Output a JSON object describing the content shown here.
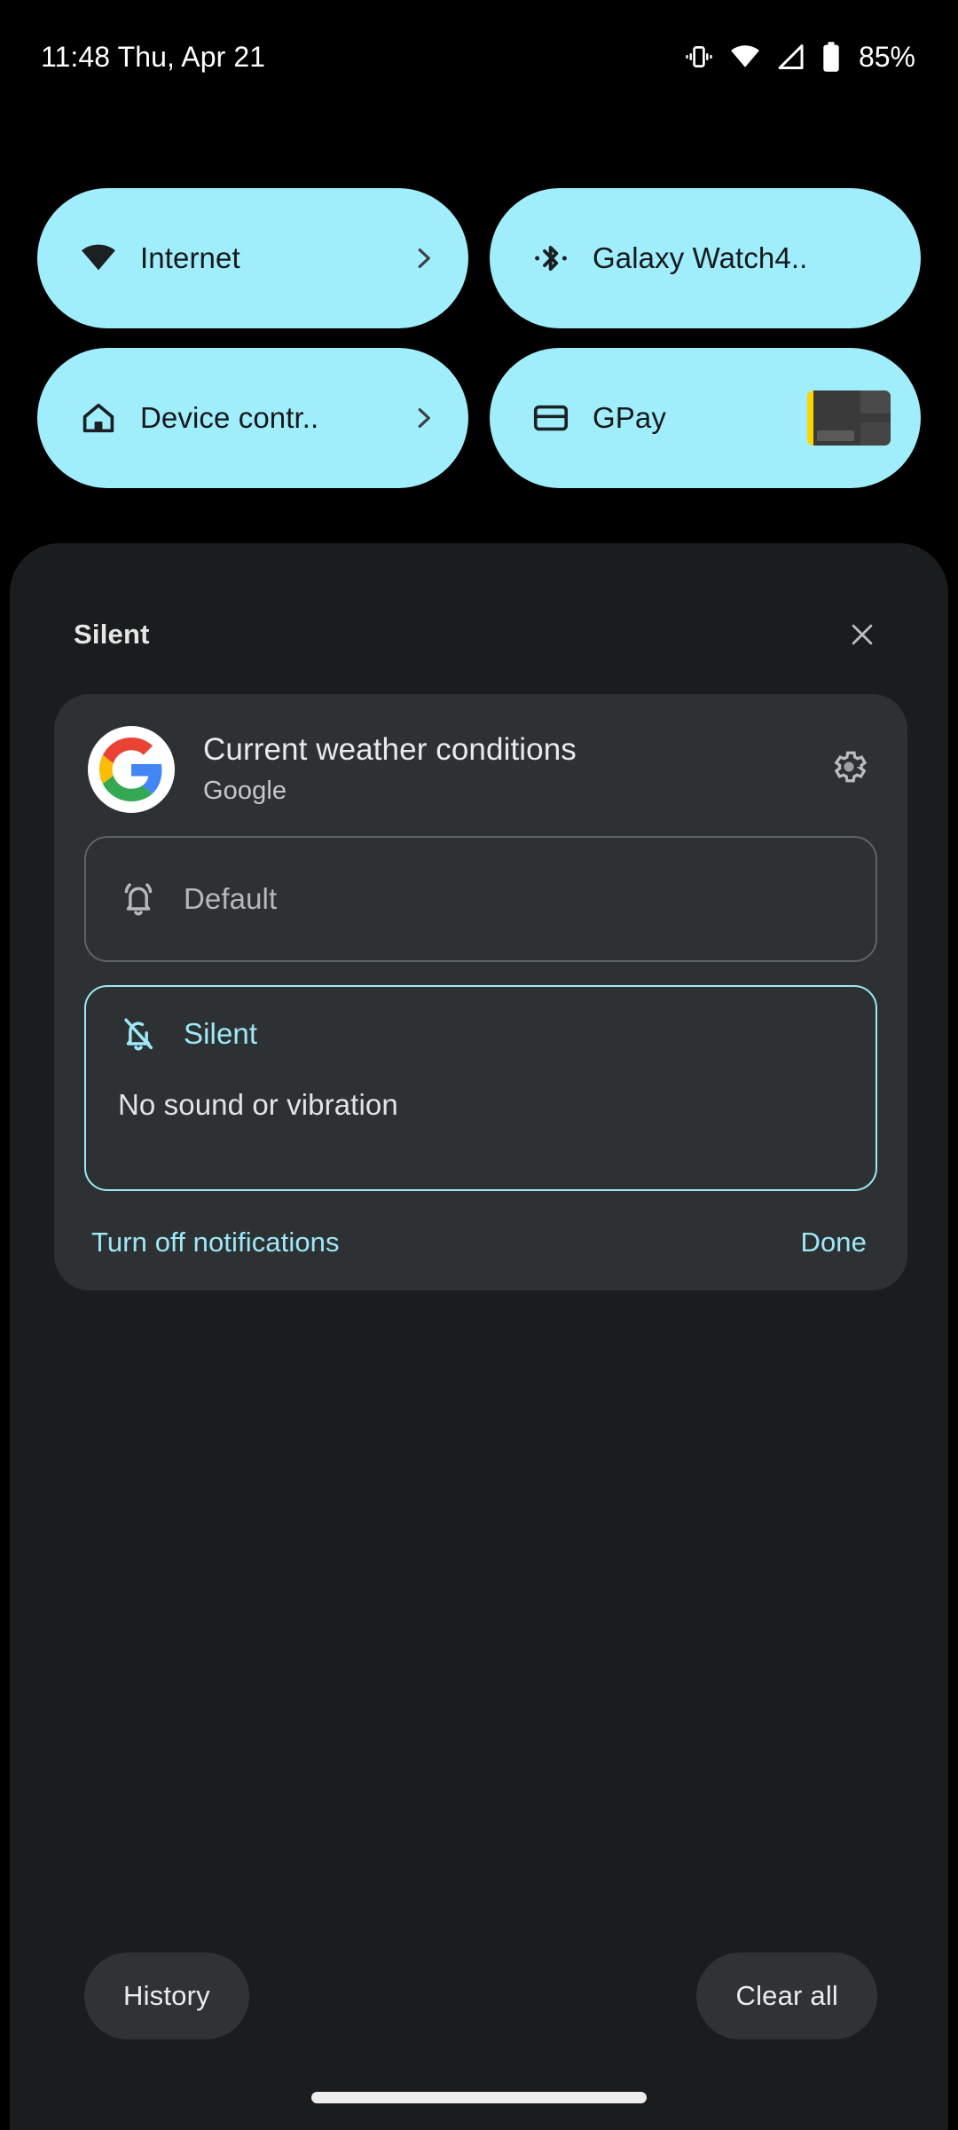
{
  "status_bar": {
    "clock": "11:48 Thu, Apr 21",
    "battery_percent": "85%",
    "icons": [
      "vibrate-icon",
      "wifi-icon",
      "cell-signal-icon",
      "battery-icon"
    ]
  },
  "quick_settings": {
    "tiles": [
      {
        "label": "Internet",
        "icon": "wifi-icon",
        "accessory": "chevron"
      },
      {
        "label": "Galaxy Watch4..",
        "icon": "bluetooth-icon",
        "accessory": "none"
      },
      {
        "label": "Device contr..",
        "icon": "home-icon",
        "accessory": "chevron"
      },
      {
        "label": "GPay",
        "icon": "credit-card-icon",
        "accessory": "card-thumb"
      }
    ],
    "tile_color": "#A0EEFC",
    "tile_text_color": "#15191B"
  },
  "shade": {
    "title": "Silent",
    "close_icon": "close-icon",
    "notification": {
      "app_icon": "google-g-icon",
      "title": "Current weather conditions",
      "app_name": "Google",
      "settings_icon": "gear-icon",
      "options": [
        {
          "label": "Default",
          "icon": "bell-ringing-icon",
          "description": "",
          "selected": false
        },
        {
          "label": "Silent",
          "icon": "bell-off-icon",
          "description": "No sound or vibration",
          "selected": true
        }
      ],
      "turn_off_label": "Turn off notifications",
      "done_label": "Done"
    },
    "footer": {
      "history_label": "History",
      "clear_all_label": "Clear all"
    },
    "accent_color": "#9DE9F7",
    "panel_color": "#1A1C1E",
    "card_color": "#2E3133"
  }
}
